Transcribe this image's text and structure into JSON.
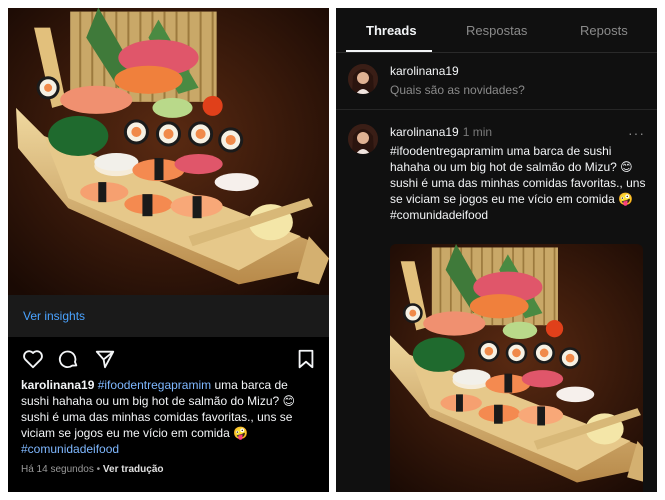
{
  "instagram": {
    "insights_link": "Ver insights",
    "icons": [
      "heart-icon",
      "comment-icon",
      "share-icon",
      "bookmark-icon"
    ],
    "caption": {
      "username": "karolinana19",
      "hashtag_main": "#ifoodentregapramim",
      "text_1": "uma barca de sushi hahaha ou um big hot de salmão do Mizu?",
      "emoji_1": "😊",
      "text_2": "sushi é uma das minhas comidas favoritas., uns se viciam se jogos eu me vício em comida",
      "emoji_2": "🤪",
      "hashtag_end": "#comunidadeifood"
    },
    "time_ago": "Há 14 segundos",
    "separator": "•",
    "translate_link": "Ver tradução"
  },
  "threads": {
    "tabs": [
      "Threads",
      "Respostas",
      "Reposts"
    ],
    "active_tab": "Threads",
    "compose": {
      "username": "karolinana19",
      "placeholder": "Quais são as novidades?"
    },
    "post": {
      "username": "karolinana19",
      "time": "1 min",
      "more": "···",
      "hashtag_main": "#ifoodentregapramim",
      "text_1": "uma barca de sushi hahaha ou um big hot de salmão do Mizu?",
      "emoji_1": "😊",
      "text_2": "sushi é uma das minhas comidas favoritas., uns se viciam se jogos eu me vício em comida",
      "emoji_2": "🤪",
      "hashtag_end": "#comunidadeifood"
    }
  },
  "colors": {
    "link_blue": "#4aa3ff",
    "hashtag_blue": "#7fb8ff",
    "panel_dark": "#000000"
  }
}
